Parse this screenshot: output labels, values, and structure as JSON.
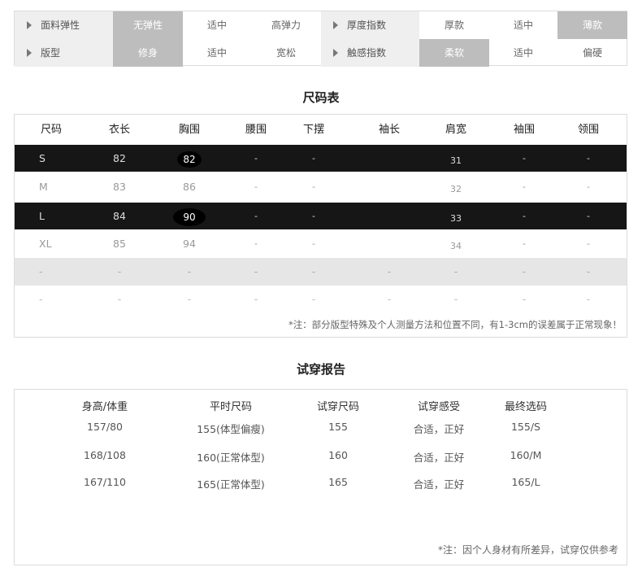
{
  "attributes": {
    "rows": [
      {
        "groups": [
          {
            "label": "面料弹性",
            "options": [
              {
                "text": "无弹性",
                "selected": true
              },
              {
                "text": "适中",
                "selected": false
              },
              {
                "text": "高弹力",
                "selected": false
              }
            ]
          },
          {
            "label": "厚度指数",
            "options": [
              {
                "text": "厚款",
                "selected": false
              },
              {
                "text": "适中",
                "selected": false
              },
              {
                "text": "薄款",
                "selected": true
              }
            ]
          }
        ]
      },
      {
        "groups": [
          {
            "label": "版型",
            "options": [
              {
                "text": "修身",
                "selected": true
              },
              {
                "text": "适中",
                "selected": false
              },
              {
                "text": "宽松",
                "selected": false
              }
            ]
          },
          {
            "label": "触感指数",
            "options": [
              {
                "text": "柔软",
                "selected": true
              },
              {
                "text": "适中",
                "selected": false
              },
              {
                "text": "偏硬",
                "selected": false
              }
            ]
          }
        ]
      }
    ]
  },
  "size_chart": {
    "title": "尺码表",
    "headers": [
      "尺码",
      "衣长",
      "胸围",
      "腰围",
      "下摆",
      "袖长",
      "肩宽",
      "袖围",
      "领围"
    ],
    "rows": [
      [
        "S",
        "82",
        "82",
        "-",
        "-",
        "",
        "31",
        "-",
        "-"
      ],
      [
        "M",
        "83",
        "86",
        "-",
        "-",
        "",
        "32",
        "-",
        "-"
      ],
      [
        "L",
        "84",
        "90",
        "-",
        "-",
        "",
        "33",
        "-",
        "-"
      ],
      [
        "XL",
        "85",
        "94",
        "-",
        "-",
        "",
        "34",
        "-",
        "-"
      ],
      [
        "-",
        "-",
        "-",
        "-",
        "-",
        "-",
        "-",
        "-",
        "-"
      ],
      [
        "-",
        "-",
        "-",
        "-",
        "-",
        "-",
        "-",
        "-",
        "-"
      ]
    ],
    "note": "*注：部分版型特殊及个人测量方法和位置不同，有1-3cm的误差属于正常现象！"
  },
  "fitting_report": {
    "title": "试穿报告",
    "headers": [
      "身高/体重",
      "平时尺码",
      "试穿尺码",
      "试穿感受",
      "最终选码"
    ],
    "rows": [
      [
        "157/80",
        "155(体型偏瘦)",
        "155",
        "合适，正好",
        "155/S"
      ],
      [
        "168/108",
        "160(正常体型)",
        "160",
        "合适，正好",
        "160/M"
      ],
      [
        "167/110",
        "165(正常体型)",
        "165",
        "合适，正好",
        "165/L"
      ]
    ],
    "note": "*注：因个人身材有所差异，试穿仅供参考"
  }
}
